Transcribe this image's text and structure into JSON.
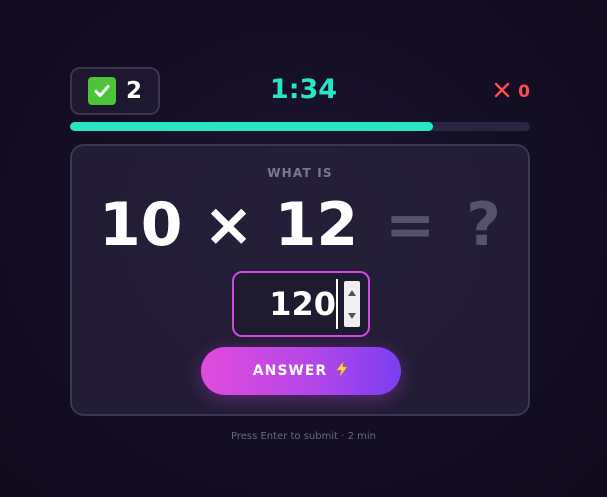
{
  "score": {
    "correct_count": "2",
    "wrong_count": "0",
    "check_icon": "check-icon",
    "wrong_icon": "close-icon"
  },
  "timer": {
    "value": "1:34"
  },
  "progress": {
    "fraction_remaining": 0.789,
    "color": "#26e6c4"
  },
  "question": {
    "prompt": "WHAT IS",
    "operand_a": "10",
    "operator": "×",
    "operand_b": "12",
    "equals": "=",
    "unknown": "?"
  },
  "answer": {
    "value": "120",
    "submit_label": "ANSWER",
    "submit_icon": "lightning-icon"
  },
  "hint": "Press Enter to submit · 2 min",
  "colors": {
    "accent_teal": "#26e6c4",
    "accent_pink": "#d04ae0",
    "correct_green": "#4ec33a",
    "wrong_red": "#ff4c4c"
  }
}
